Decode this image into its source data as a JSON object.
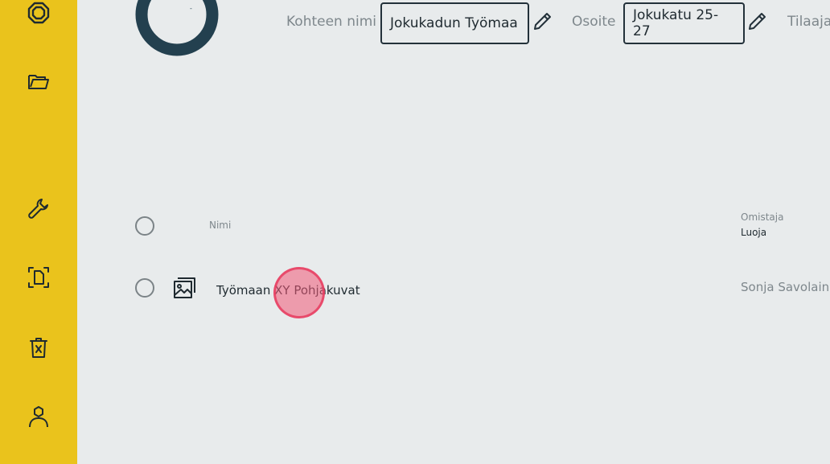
{
  "sidebar": {
    "items": [
      {
        "icon": "octagon-icon"
      },
      {
        "icon": "folder-icon"
      },
      {
        "icon": "wrench-icon"
      },
      {
        "icon": "document-scan-icon"
      },
      {
        "icon": "trash-icon"
      },
      {
        "icon": "user-icon"
      }
    ],
    "accent_color": "#eac31c"
  },
  "header": {
    "ring_label": "-",
    "fields": [
      {
        "label": "Kohteen nimi",
        "value": "Jokukadun Työmaa"
      },
      {
        "label": "Osoite",
        "value": "Jokukatu 25-27"
      },
      {
        "label": "Tilaaja"
      }
    ]
  },
  "table": {
    "columns": {
      "name": "Nimi",
      "owner": "Omistaja",
      "creator": "Luoja"
    },
    "rows": [
      {
        "icon": "image-icon",
        "name": "Työmaan XY Pohjakuvat",
        "owner": "Sonja Savolainen"
      }
    ]
  }
}
